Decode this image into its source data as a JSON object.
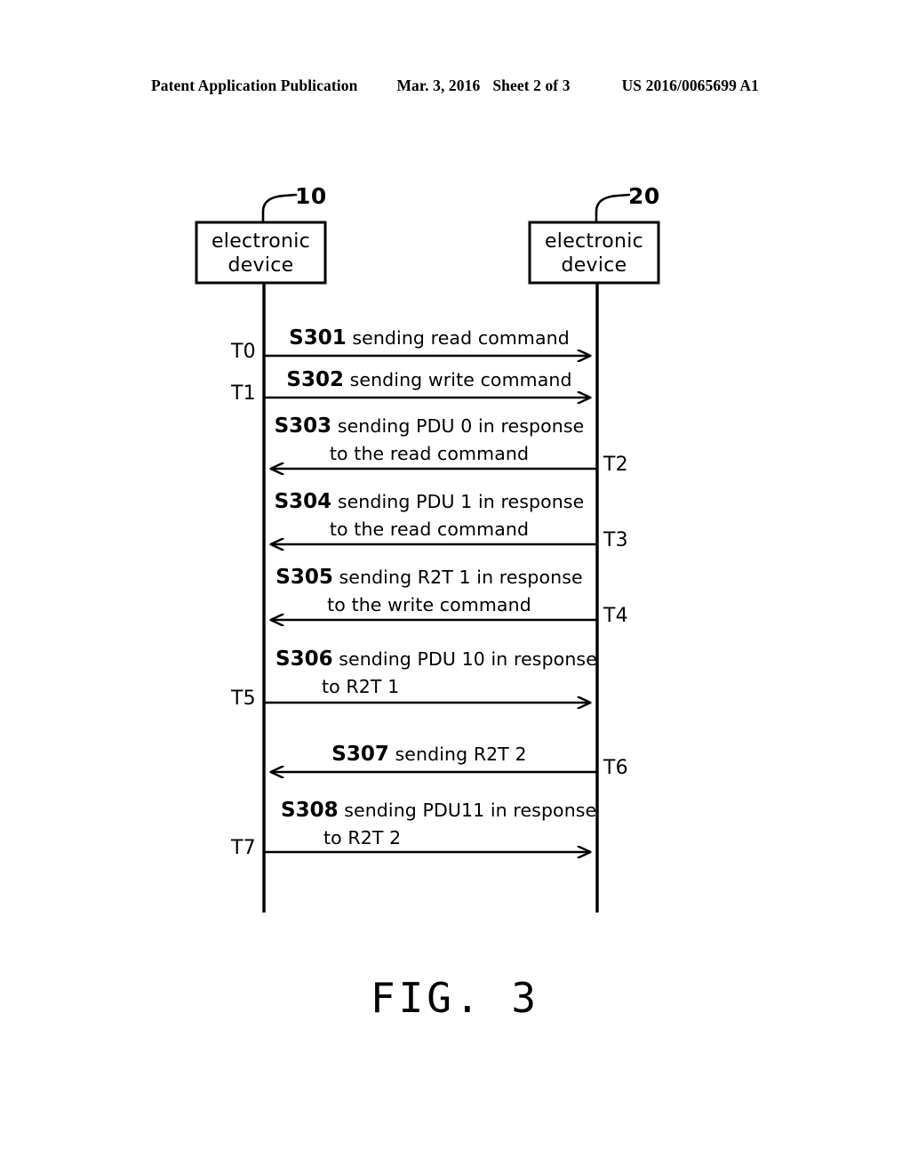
{
  "header": {
    "publication": "Patent Application Publication",
    "date": "Mar. 3, 2016",
    "sheet": "Sheet 2 of 3",
    "document_number": "US 2016/0065699 A1"
  },
  "figure": {
    "caption": "FIG. 3",
    "lifelines": [
      {
        "id": "left",
        "ref": "10",
        "title_line1": "electronic",
        "title_line2": "device"
      },
      {
        "id": "right",
        "ref": "20",
        "title_line1": "electronic",
        "title_line2": "device"
      }
    ],
    "messages": [
      {
        "code": "S301",
        "text_line1": "sending read command",
        "text_line2": "",
        "direction": "left-to-right",
        "time_label": "T0",
        "time_side": "left"
      },
      {
        "code": "S302",
        "text_line1": "sending write command",
        "text_line2": "",
        "direction": "left-to-right",
        "time_label": "T1",
        "time_side": "left"
      },
      {
        "code": "S303",
        "text_line1": "sending PDU 0 in response",
        "text_line2": "to the read command",
        "direction": "right-to-left",
        "time_label": "T2",
        "time_side": "right"
      },
      {
        "code": "S304",
        "text_line1": "sending PDU 1 in response",
        "text_line2": "to the read command",
        "direction": "right-to-left",
        "time_label": "T3",
        "time_side": "right"
      },
      {
        "code": "S305",
        "text_line1": "sending R2T 1 in response",
        "text_line2": "to the write command",
        "direction": "right-to-left",
        "time_label": "T4",
        "time_side": "right"
      },
      {
        "code": "S306",
        "text_line1": "sending PDU 10 in response",
        "text_line2": "to R2T 1",
        "direction": "left-to-right",
        "time_label": "T5",
        "time_side": "left"
      },
      {
        "code": "S307",
        "text_line1": "sending R2T 2",
        "text_line2": "",
        "direction": "right-to-left",
        "time_label": "T6",
        "time_side": "right"
      },
      {
        "code": "S308",
        "text_line1": "sending PDU11 in response",
        "text_line2": "to R2T 2",
        "direction": "left-to-right",
        "time_label": "T7",
        "time_side": "left"
      }
    ]
  },
  "colors": {
    "ink": "#000000",
    "paper": "#ffffff"
  }
}
